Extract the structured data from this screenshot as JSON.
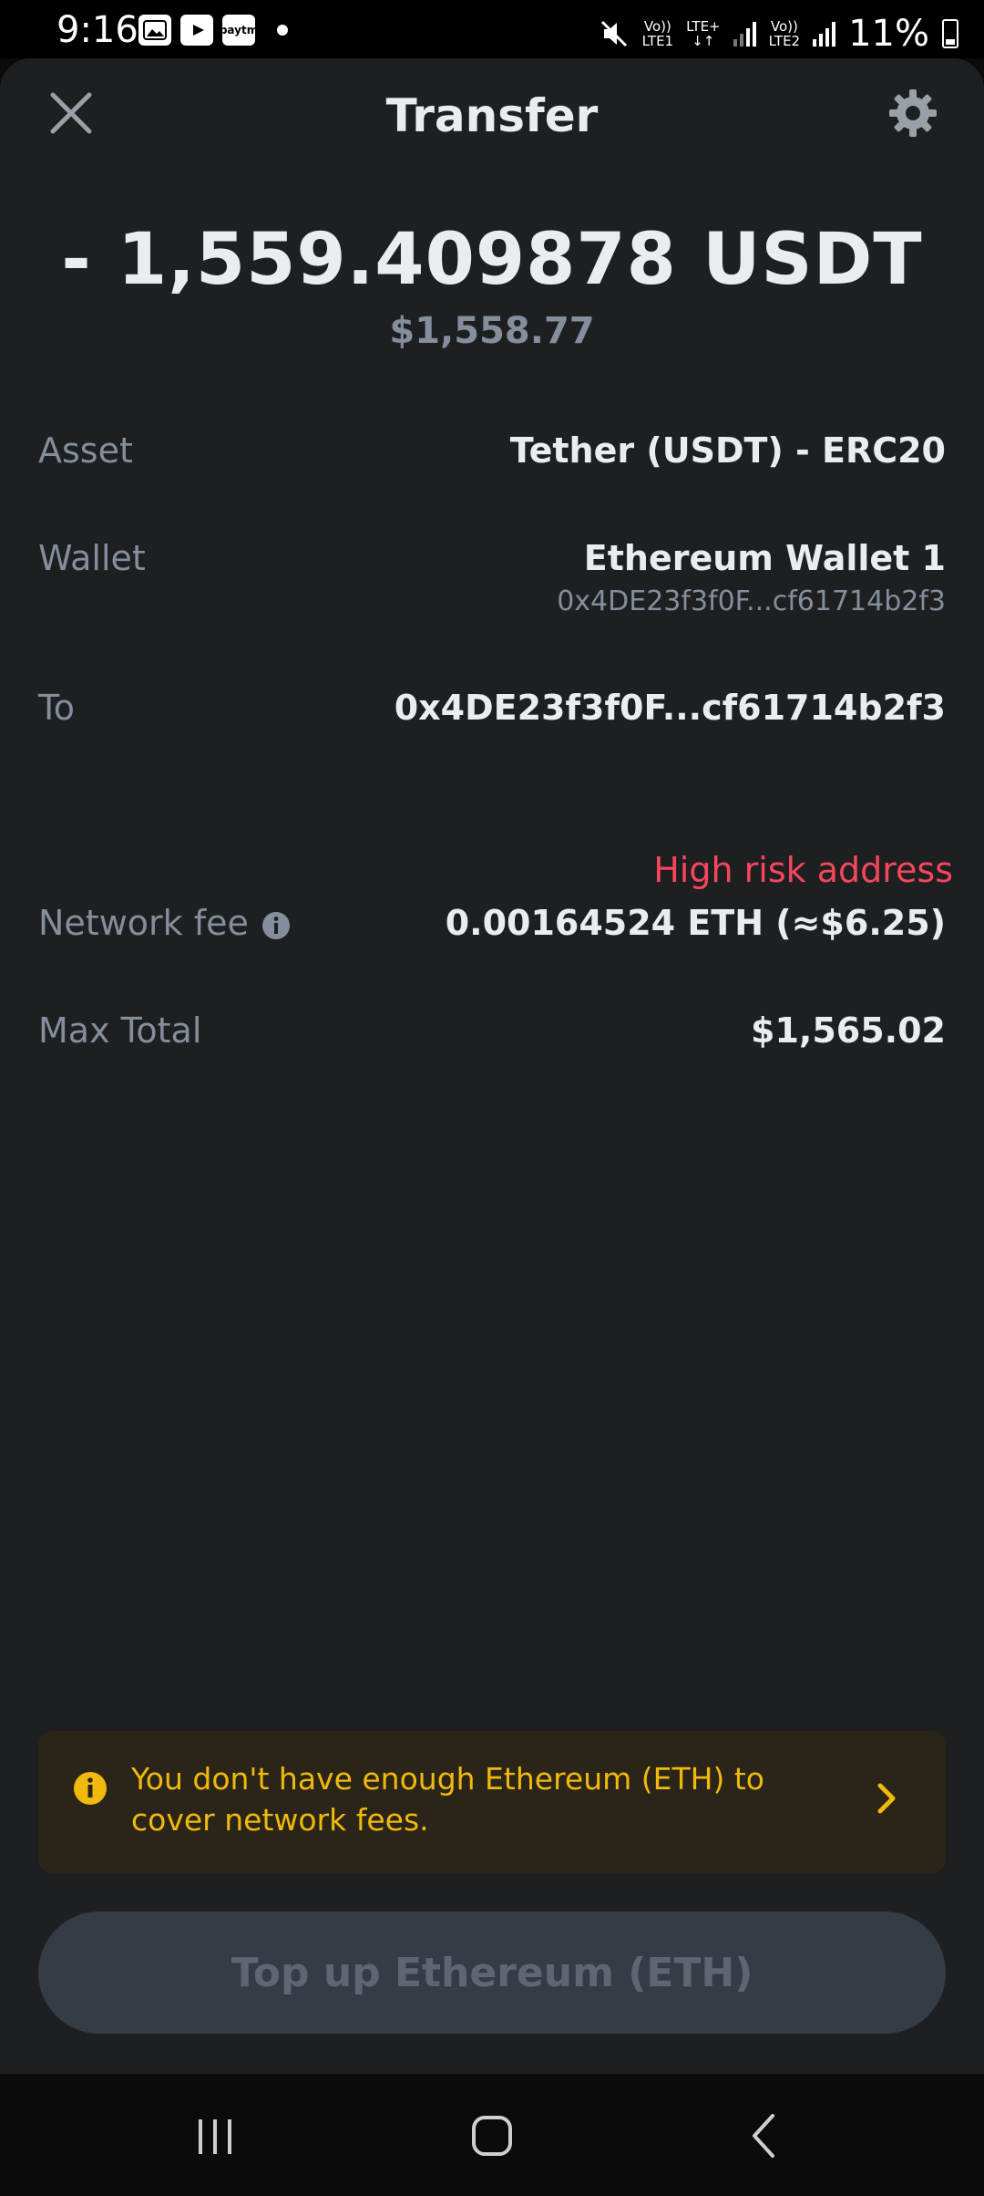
{
  "status_bar": {
    "time": "9:16",
    "app_icons": [
      "gallery-icon",
      "youtube-icon",
      "paytm-icon"
    ],
    "paytm_label": "paytm",
    "sim1_top": "Vo))",
    "sim1_bottom": "LTE1",
    "lte_top": "LTE+",
    "sim2_top": "Vo))",
    "sim2_bottom": "LTE2",
    "battery": "11%"
  },
  "header": {
    "title": "Transfer"
  },
  "amount": {
    "crypto": "- 1,559.409878 USDT",
    "fiat": "$1,558.77"
  },
  "details": {
    "asset_label": "Asset",
    "asset_value": "Tether (USDT) - ERC20",
    "wallet_label": "Wallet",
    "wallet_name": "Ethereum Wallet 1",
    "wallet_address": "0x4DE23f3f0F...cf61714b2f3",
    "to_label": "To",
    "to_value": "0x4DE23f3f0F...cf61714b2f3",
    "risk_text": "High risk address",
    "fee_label": "Network fee",
    "fee_value": "0.00164524 ETH (≈$6.25)",
    "total_label": "Max Total",
    "total_value": "$1,565.02"
  },
  "warning": {
    "text": "You don't have enough Ethereum (ETH) to cover network fees."
  },
  "cta": {
    "label": "Top up Ethereum (ETH)"
  },
  "colors": {
    "background": "#1e1f21",
    "label": "#848e9c",
    "danger": "#f6465d",
    "warning": "#f0b90b",
    "button_disabled": "#363c46"
  }
}
